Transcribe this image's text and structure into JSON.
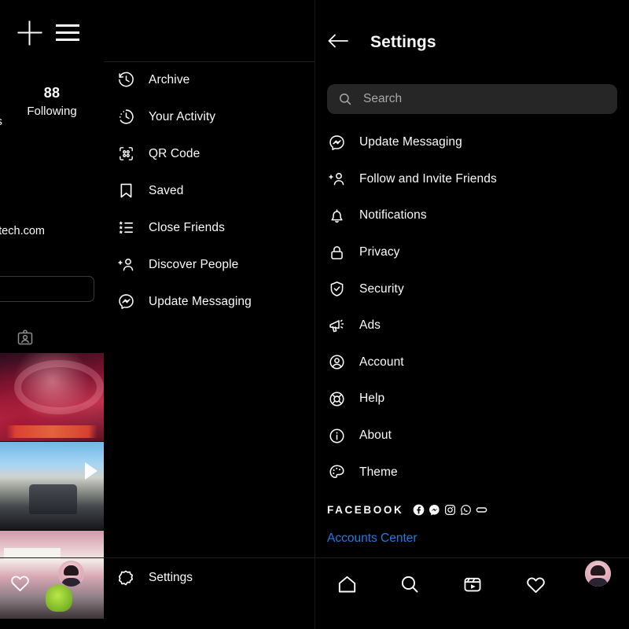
{
  "colors": {
    "background": "#000000",
    "text": "#fafafa",
    "muted_text": "#a8a8a8",
    "search_field": "#262626",
    "link_blue": "#1e7ce0",
    "divider": "#1c1c1c"
  },
  "left_phone": {
    "topbar": {
      "add_icon": "plus-icon",
      "menu_icon": "hamburger-icon"
    },
    "profile": {
      "following_count": "88",
      "following_label": "Following",
      "followers_label_partial": "ers",
      "website_partial": "nfotech.com",
      "edit_profile_button_label": "",
      "id_card_icon": "id-card-icon"
    },
    "thumbnails": [
      {
        "name": "avengers-poster-thumbnail",
        "alt": "Avengers movie poster"
      },
      {
        "name": "dashcam-road-thumbnail",
        "alt": "Dashcam highway video"
      },
      {
        "name": "desk-green-object-thumbnail",
        "alt": "Pink desk with green object"
      }
    ],
    "bottom_bar": {
      "heart_icon": "heart-icon",
      "avatar": "profile-avatar"
    }
  },
  "menu_panel": {
    "items": [
      {
        "label": "Archive",
        "icon": "archive-clock-icon"
      },
      {
        "label": "Your Activity",
        "icon": "activity-clock-icon"
      },
      {
        "label": "QR Code",
        "icon": "qr-code-icon"
      },
      {
        "label": "Saved",
        "icon": "bookmark-icon"
      },
      {
        "label": "Close Friends",
        "icon": "star-list-icon"
      },
      {
        "label": "Discover People",
        "icon": "add-person-icon"
      },
      {
        "label": "Update Messaging",
        "icon": "messenger-icon"
      }
    ],
    "footer": {
      "label": "Settings",
      "icon": "gear-icon"
    }
  },
  "right_phone": {
    "header": {
      "back_icon": "back-arrow-icon",
      "title": "Settings"
    },
    "search": {
      "placeholder": "Search",
      "icon": "search-icon",
      "value": ""
    },
    "items": [
      {
        "label": "Update Messaging",
        "icon": "messenger-icon"
      },
      {
        "label": "Follow and Invite Friends",
        "icon": "add-person-icon"
      },
      {
        "label": "Notifications",
        "icon": "bell-icon"
      },
      {
        "label": "Privacy",
        "icon": "lock-icon"
      },
      {
        "label": "Security",
        "icon": "shield-check-icon"
      },
      {
        "label": "Ads",
        "icon": "megaphone-icon"
      },
      {
        "label": "Account",
        "icon": "account-person-icon"
      },
      {
        "label": "Help",
        "icon": "life-preserver-icon"
      },
      {
        "label": "About",
        "icon": "info-circle-icon"
      },
      {
        "label": "Theme",
        "icon": "palette-icon"
      }
    ],
    "facebook_section": {
      "title": "FACEBOOK",
      "brand_icons": [
        "facebook-icon",
        "messenger-icon",
        "instagram-icon",
        "whatsapp-icon",
        "portal-icon"
      ],
      "accounts_center_link": "Accounts Center"
    },
    "bottom_nav": [
      {
        "name": "home",
        "icon": "home-icon"
      },
      {
        "name": "search",
        "icon": "search-icon"
      },
      {
        "name": "reels",
        "icon": "reels-icon"
      },
      {
        "name": "activity",
        "icon": "heart-icon"
      },
      {
        "name": "profile",
        "icon": "profile-avatar"
      }
    ]
  }
}
